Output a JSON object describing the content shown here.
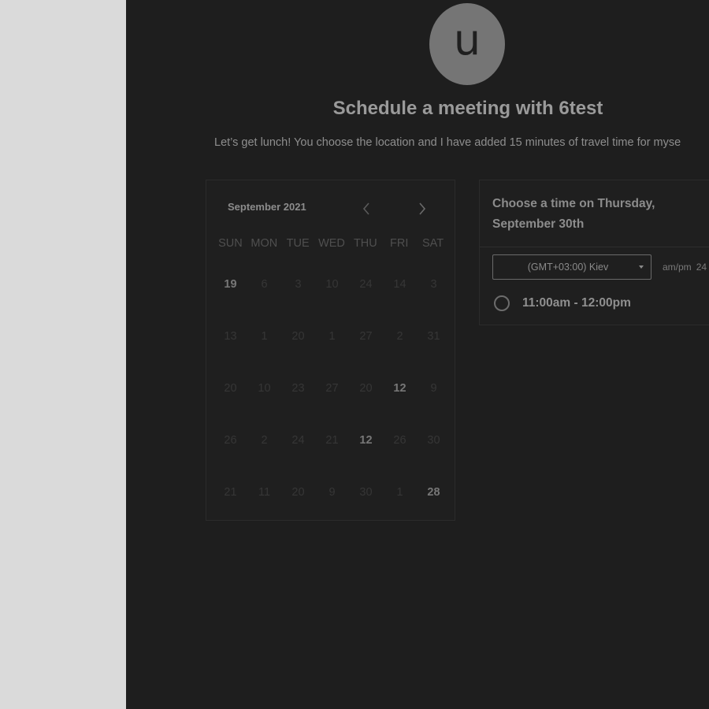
{
  "header": {
    "avatar_initial": "u",
    "title": "Schedule a meeting with 6test",
    "description": "Let’s get lunch! You choose the location and I have added 15 minutes of travel time for myse"
  },
  "calendar": {
    "month_label": "September 2021",
    "prev_icon": "chevron-left-icon",
    "next_icon": "chevron-right-icon",
    "weekdays": [
      "SUN",
      "MON",
      "TUE",
      "WED",
      "THU",
      "FRI",
      "SAT"
    ],
    "weeks": [
      [
        "19",
        "6",
        "3",
        "10",
        "24",
        "14",
        "3"
      ],
      [
        "13",
        "1",
        "20",
        "1",
        "27",
        "2",
        "31"
      ],
      [
        "20",
        "10",
        "23",
        "27",
        "20",
        "12",
        "9"
      ],
      [
        "26",
        "2",
        "24",
        "21",
        "12",
        "26",
        "30"
      ],
      [
        "21",
        "11",
        "20",
        "9",
        "30",
        "1",
        "28"
      ]
    ]
  },
  "time_panel": {
    "heading": "Choose a time on Thursday, September 30th",
    "timezone": "(GMT+03:00) Kiev",
    "format_ampm": "am/pm",
    "format_24": "24",
    "slots": [
      "11:00am - 12:00pm"
    ]
  },
  "colors": {
    "panel_bg": "#1e1e1e",
    "gutter_bg": "#dadada",
    "avatar_bg": "#757575"
  }
}
